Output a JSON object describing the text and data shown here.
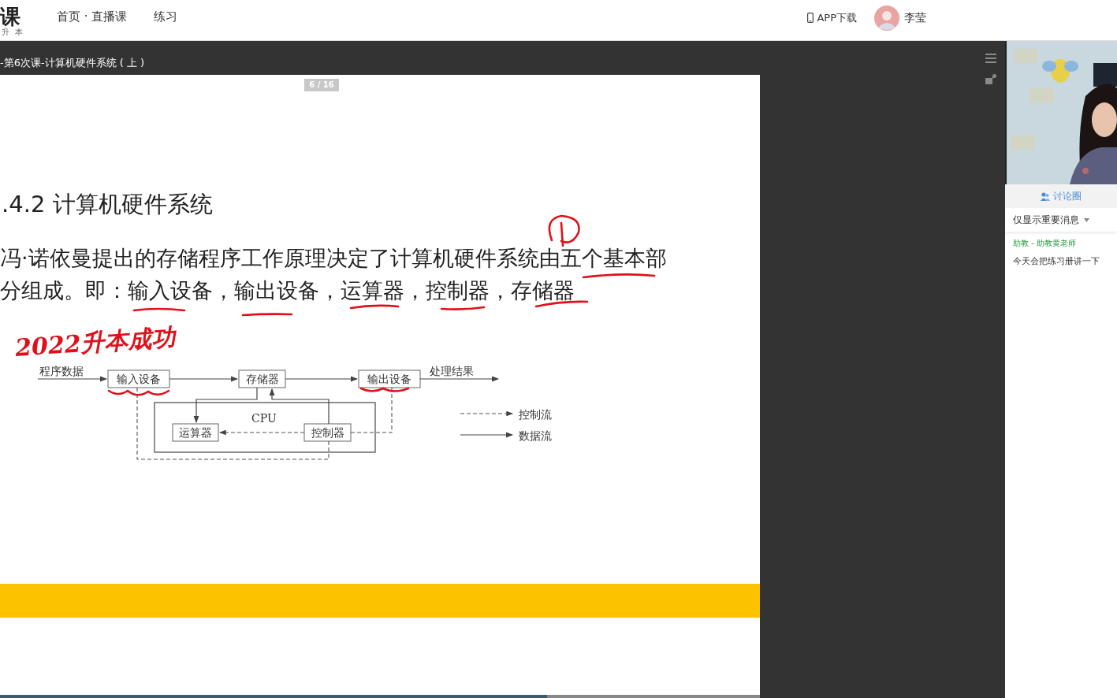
{
  "header": {
    "logo": {
      "text": "课",
      "subtitle": "升 本"
    },
    "nav": [
      {
        "label": "首页 · 直播课"
      },
      {
        "label": "练习"
      }
    ],
    "app_download": "APP下载",
    "user": {
      "name": "李莹"
    }
  },
  "lesson": {
    "title": "-第6次课-计算机硬件系统 ( 上 )"
  },
  "slide": {
    "page": "6 / 16",
    "heading": ".4.2 计算机硬件系统",
    "paragraph": "冯·诺依曼提出的存储程序工作原理决定了计算机硬件系统由五个基本部分组成。即：输入设备，输出设备，运算器，控制器，存储器",
    "handwriting": "2022升本成功",
    "diagram": {
      "input_label": "程序数据",
      "output_label": "处理结果",
      "cpu_label": "CPU",
      "nodes": [
        {
          "label": "输入设备"
        },
        {
          "label": "存储器"
        },
        {
          "label": "输出设备"
        },
        {
          "label": "运算器"
        },
        {
          "label": "控制器"
        }
      ],
      "legend": [
        {
          "kind": "dashed",
          "label": "控制流"
        },
        {
          "kind": "solid",
          "label": "数据流"
        }
      ]
    },
    "progress": {
      "level": 0.72
    }
  },
  "chat": {
    "tab": "讨论圈",
    "filter": "仅显示重要消息",
    "messages": [
      {
        "sender": "助教 - 助教黄老师",
        "text": "今天会把练习册讲一下"
      }
    ]
  }
}
